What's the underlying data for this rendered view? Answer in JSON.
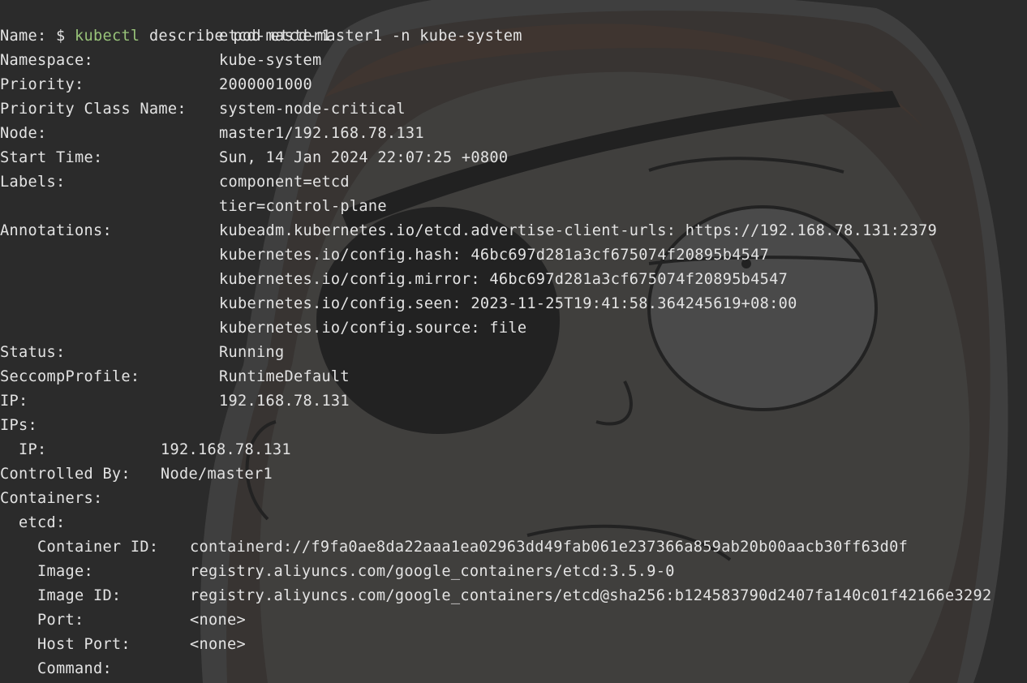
{
  "prompt": {
    "symbol": "$",
    "command": "kubectl",
    "args": "describe pod etcd-master1 -n kube-system"
  },
  "lines": [
    {
      "key": "Name:",
      "value": "etcd-master1"
    },
    {
      "key": "Namespace:",
      "value": "kube-system"
    },
    {
      "key": "Priority:",
      "value": "2000001000"
    },
    {
      "key": "Priority Class Name:",
      "value": "system-node-critical"
    },
    {
      "key": "Node:",
      "value": "master1/192.168.78.131"
    },
    {
      "key": "Start Time:",
      "value": "Sun, 14 Jan 2024 22:07:25 +0800"
    },
    {
      "key": "Labels:",
      "value": "component=etcd"
    },
    {
      "key": "",
      "value": "tier=control-plane"
    },
    {
      "key": "Annotations:",
      "value": "kubeadm.kubernetes.io/etcd.advertise-client-urls: https://192.168.78.131:2379"
    },
    {
      "key": "",
      "value": "kubernetes.io/config.hash: 46bc697d281a3cf675074f20895b4547"
    },
    {
      "key": "",
      "value": "kubernetes.io/config.mirror: 46bc697d281a3cf675074f20895b4547"
    },
    {
      "key": "",
      "value": "kubernetes.io/config.seen: 2023-11-25T19:41:58.364245619+08:00"
    },
    {
      "key": "",
      "value": "kubernetes.io/config.source: file"
    },
    {
      "key": "Status:",
      "value": "Running"
    },
    {
      "key": "SeccompProfile:",
      "value": "RuntimeDefault"
    },
    {
      "key": "IP:",
      "value": "192.168.78.131"
    },
    {
      "key": "IPs:",
      "value": ""
    },
    {
      "key": "  IP:",
      "value": "192.168.78.131"
    },
    {
      "key": "Controlled By:",
      "value": "Node/master1"
    },
    {
      "key": "Containers:",
      "value": ""
    },
    {
      "key": "  etcd:",
      "value": ""
    },
    {
      "key": "    Container ID:",
      "value": "containerd://f9fa0ae8da22aaa1ea02963dd49fab061e237366a859ab20b00aacb30ff63d0f"
    },
    {
      "key": "    Image:",
      "value": "registry.aliyuncs.com/google_containers/etcd:3.5.9-0"
    },
    {
      "key": "    Image ID:",
      "value": "registry.aliyuncs.com/google_containers/etcd@sha256:b124583790d2407fa140c01f42166e3292"
    },
    {
      "key": "    Port:",
      "value": "<none>"
    },
    {
      "key": "    Host Port:",
      "value": "<none>"
    },
    {
      "key": "    Command:",
      "value": ""
    }
  ],
  "colors": {
    "background": "#2c2c2c",
    "text": "#e3e3e3",
    "command": "#98c379"
  },
  "wallpaper": {
    "icon": "morty-eyepatch-sticker-icon"
  }
}
